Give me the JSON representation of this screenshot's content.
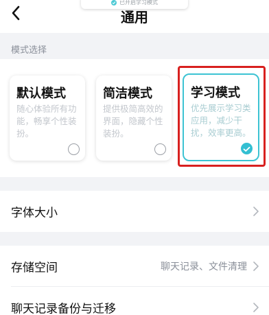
{
  "header": {
    "title": "通用",
    "toast_text": "已开启学习模式"
  },
  "mode_section": {
    "label": "模式选择",
    "cards": [
      {
        "title": "默认模式",
        "desc": "随心体验所有功能，畅享个性装扮。",
        "selected": false
      },
      {
        "title": "简洁模式",
        "desc": "提供极简高效的界面，隐藏个性装扮。",
        "selected": false
      },
      {
        "title": "学习模式",
        "desc": "优先展示学习类应用，减少干扰，效率更高。",
        "selected": true
      }
    ]
  },
  "rows": [
    {
      "label": "字体大小",
      "value": ""
    },
    {
      "label": "存储空间",
      "value": "聊天记录、文件清理"
    },
    {
      "label": "聊天记录备份与迁移",
      "value": ""
    }
  ],
  "colors": {
    "accent": "#33bfd2",
    "highlight": "#d8201f",
    "background": "#f2f3f6"
  },
  "icons": {
    "back": "chevron-left-icon",
    "row_arrow": "chevron-right-icon",
    "checked": "check-icon"
  }
}
